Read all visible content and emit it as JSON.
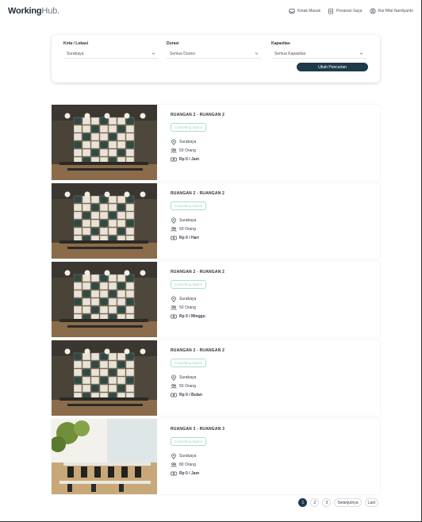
{
  "header": {
    "logo_main": "Working",
    "logo_suffix": "Hub.",
    "nav": [
      {
        "label": "Kotak Masuk",
        "icon": "inbox-icon"
      },
      {
        "label": "Pesanan Saya",
        "icon": "clipboard-icon"
      },
      {
        "label": "Rai Rifal Nardiyanto",
        "icon": "user-icon"
      }
    ]
  },
  "search": {
    "fields": [
      {
        "label": "Kota / Lokasi",
        "value": "Surabaya"
      },
      {
        "label": "Durasi",
        "value": "Semua Durasi"
      },
      {
        "label": "Kapasitas",
        "value": "Semua Kapasitas"
      }
    ],
    "button_label": "Ubah Pencarian"
  },
  "listings": [
    {
      "title": "RUANGAN 2 - RUANGAN 2",
      "badge": "Coworking Space",
      "location": "Surabaya",
      "capacity": "50 Orang",
      "price": "Rp 0 / Jam",
      "image": "dark-wall"
    },
    {
      "title": "RUANGAN 2 - RUANGAN 2",
      "badge": "Coworking Space",
      "location": "Surabaya",
      "capacity": "50 Orang",
      "price": "Rp 0 / Hari",
      "image": "dark-wall"
    },
    {
      "title": "RUANGAN 2 - RUANGAN 2",
      "badge": "Coworking Space",
      "location": "Surabaya",
      "capacity": "50 Orang",
      "price": "Rp 0 / Minggu",
      "image": "dark-wall"
    },
    {
      "title": "RUANGAN 2 - RUANGAN 2",
      "badge": "Coworking Space",
      "location": "Surabaya",
      "capacity": "50 Orang",
      "price": "Rp 0 / Bulan",
      "image": "dark-wall"
    },
    {
      "title": "RUANGAN 3 - RUANGAN 3",
      "badge": "Coworking Space",
      "location": "Surabaya",
      "capacity": "80 Orang",
      "price": "Rp 0 / Jam",
      "image": "bright-office"
    }
  ],
  "pagination": {
    "pages": [
      "1",
      "2",
      "3"
    ],
    "active": "1",
    "next_label": "Selanjutnya",
    "last_label": "Last"
  },
  "colors": {
    "primary": "#1d3b4b",
    "badge": "#9bd6c4"
  }
}
